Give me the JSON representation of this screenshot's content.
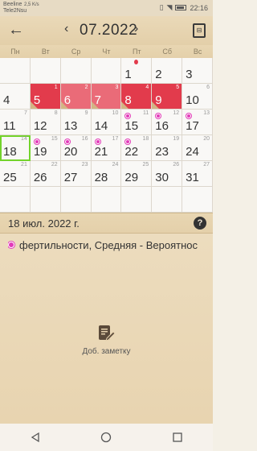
{
  "status_bar": {
    "carrier_1": "Beeline",
    "carrier_2": "Tele2Nsu",
    "net_speed": "2,5 K/s",
    "time": "22:16"
  },
  "header": {
    "month_label": "07.2022",
    "back_icon": "arrow-left-icon",
    "prev_icon": "chevron-left-icon",
    "next_icon": "chevron-right-icon",
    "calculator_icon": "calculator-icon"
  },
  "weekdays": [
    "Пн",
    "Вт",
    "Ср",
    "Чт",
    "Пт",
    "Сб",
    "Вс"
  ],
  "calendar": {
    "weeks": [
      [
        {
          "day": ""
        },
        {
          "day": ""
        },
        {
          "day": ""
        },
        {
          "day": ""
        },
        {
          "day": "1",
          "drop": true
        },
        {
          "day": "2"
        },
        {
          "day": "3"
        }
      ],
      [
        {
          "day": "4"
        },
        {
          "day": "5",
          "small": "1",
          "period": true
        },
        {
          "day": "6",
          "small": "2",
          "period": true,
          "light": true
        },
        {
          "day": "7",
          "small": "3",
          "period": true,
          "light": true
        },
        {
          "day": "8",
          "small": "4",
          "period": true
        },
        {
          "day": "9",
          "small": "5",
          "period": true
        },
        {
          "day": "10",
          "small": "6"
        }
      ],
      [
        {
          "day": "11",
          "small": "7"
        },
        {
          "day": "12",
          "small": "8"
        },
        {
          "day": "13",
          "small": "9"
        },
        {
          "day": "14",
          "small": "10"
        },
        {
          "day": "15",
          "small": "11",
          "dot": true
        },
        {
          "day": "16",
          "small": "12",
          "dot": true
        },
        {
          "day": "17",
          "small": "13",
          "dot": true
        }
      ],
      [
        {
          "day": "18",
          "small": "14",
          "today": true
        },
        {
          "day": "19",
          "small": "15",
          "dot": true
        },
        {
          "day": "20",
          "small": "16",
          "dot": true
        },
        {
          "day": "21",
          "small": "17",
          "dot": true
        },
        {
          "day": "22",
          "small": "18",
          "dot": true
        },
        {
          "day": "23",
          "small": "19"
        },
        {
          "day": "24",
          "small": "20"
        }
      ],
      [
        {
          "day": "25",
          "small": "21"
        },
        {
          "day": "26",
          "small": "22"
        },
        {
          "day": "27",
          "small": "23"
        },
        {
          "day": "28",
          "small": "24"
        },
        {
          "day": "29",
          "small": "25"
        },
        {
          "day": "30",
          "small": "26"
        },
        {
          "day": "31",
          "small": "27"
        }
      ]
    ]
  },
  "selected": {
    "date_label": "18 июл. 2022 г.",
    "help_label": "?"
  },
  "detail": {
    "fertility_text": "фертильности, Средняя - Вероятнос",
    "note_label": "Доб. заметку"
  },
  "colors": {
    "period": "#e23b4c",
    "period_light": "#ea6b78",
    "fertile_dot": "#e23ab8",
    "today_outline": "#73d32b"
  }
}
